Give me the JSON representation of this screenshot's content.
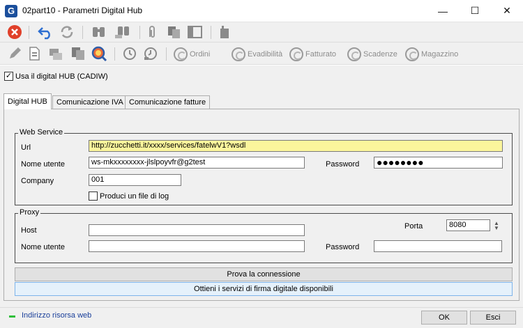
{
  "window": {
    "title": "02part10 - Parametri Digital Hub",
    "app_icon_letter": "G",
    "minimize_glyph": "—",
    "maximize_glyph": "☐",
    "close_glyph": "✕"
  },
  "toolbar2": {
    "ordini": "Ordini",
    "evadibilita": "Evadibilità",
    "fatturato": "Fatturato",
    "scadenze": "Scadenze",
    "magazzino": "Magazzino"
  },
  "toolbar_icons": [
    "close-circle-icon",
    "undo-icon",
    "refresh-icon",
    "binoculars-icon",
    "binoculars-next-icon",
    "paperclip-icon",
    "copy-icon",
    "layout-icon",
    "phone-icon",
    "edit-pencil-icon",
    "new-document-icon",
    "print-preview-icon",
    "duplicate-icon",
    "zoom-icon",
    "history-icon",
    "history-back-icon"
  ],
  "use_hub": {
    "label": "Usa il digital HUB (CADIW)",
    "checked": true
  },
  "tabs": [
    "Digital HUB",
    "Comunicazione IVA",
    "Comunicazione fatture"
  ],
  "web_service": {
    "legend": "Web Service",
    "url_label": "Url",
    "url_value": "http://zucchetti.it/xxxx/services/fatelwV1?wsdl",
    "user_label": "Nome utente",
    "user_value": "ws-mkxxxxxxxx-jlslpoyvfr@g2test",
    "password_label": "Password",
    "password_value": "●●●●●●●●",
    "company_label": "Company",
    "company_value": "001",
    "log_label": "Produci un file di log",
    "log_checked": false
  },
  "proxy": {
    "legend": "Proxy",
    "host_label": "Host",
    "host_value": "",
    "porta_label": "Porta",
    "porta_value": "8080",
    "user_label": "Nome utente",
    "user_value": "",
    "password_label": "Password",
    "password_value": ""
  },
  "actions": {
    "test": "Prova la connessione",
    "signature": "Ottieni i servizi di firma digitale disponibili"
  },
  "footer": {
    "resource_link": "Indirizzo risorsa web",
    "ok": "OK",
    "exit": "Esci"
  },
  "colors": {
    "url_field": "#fbf59c",
    "link": "#1a3f9a",
    "marker": "#2fbf3a",
    "close_icon": "#e0402a",
    "undo_icon": "#2e6fd1"
  }
}
